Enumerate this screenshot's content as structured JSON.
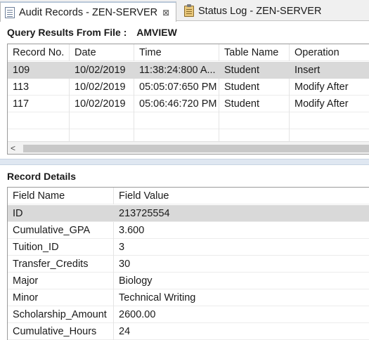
{
  "tabs": [
    {
      "label": "Audit Records - ZEN-SERVER",
      "icon": "document-icon",
      "active": true,
      "close": "⊠"
    },
    {
      "label": "Status Log - ZEN-SERVER",
      "icon": "clipboard-icon",
      "active": false
    }
  ],
  "query": {
    "title": "Query Results From File :",
    "file": "AMVIEW",
    "columns": [
      "Record No.",
      "Date",
      "Time",
      "Table Name",
      "Operation"
    ],
    "rows": [
      [
        "109",
        "10/02/2019",
        "11:38:24:800 A...",
        "Student",
        "Insert"
      ],
      [
        "113",
        "10/02/2019",
        "05:05:07:650 PM",
        "Student",
        "Modify After"
      ],
      [
        "117",
        "10/02/2019",
        "05:06:46:720 PM",
        "Student",
        "Modify After"
      ]
    ],
    "selected_row": 0,
    "scroll_left_arrow": "<"
  },
  "details": {
    "title": "Record Details",
    "columns": [
      "Field Name",
      "Field Value"
    ],
    "rows": [
      [
        "ID",
        "213725554"
      ],
      [
        "Cumulative_GPA",
        "3.600"
      ],
      [
        "Tuition_ID",
        "3"
      ],
      [
        "Transfer_Credits",
        "30"
      ],
      [
        "Major",
        "Biology"
      ],
      [
        "Minor",
        "Technical Writing"
      ],
      [
        "Scholarship_Amount",
        "2600.00"
      ],
      [
        "Cumulative_Hours",
        "24"
      ]
    ],
    "selected_row": 0
  },
  "colors": {
    "selection": "#d9d9d9",
    "splitter": "#dfe7f1",
    "tabbar": "#f0f0f0"
  }
}
